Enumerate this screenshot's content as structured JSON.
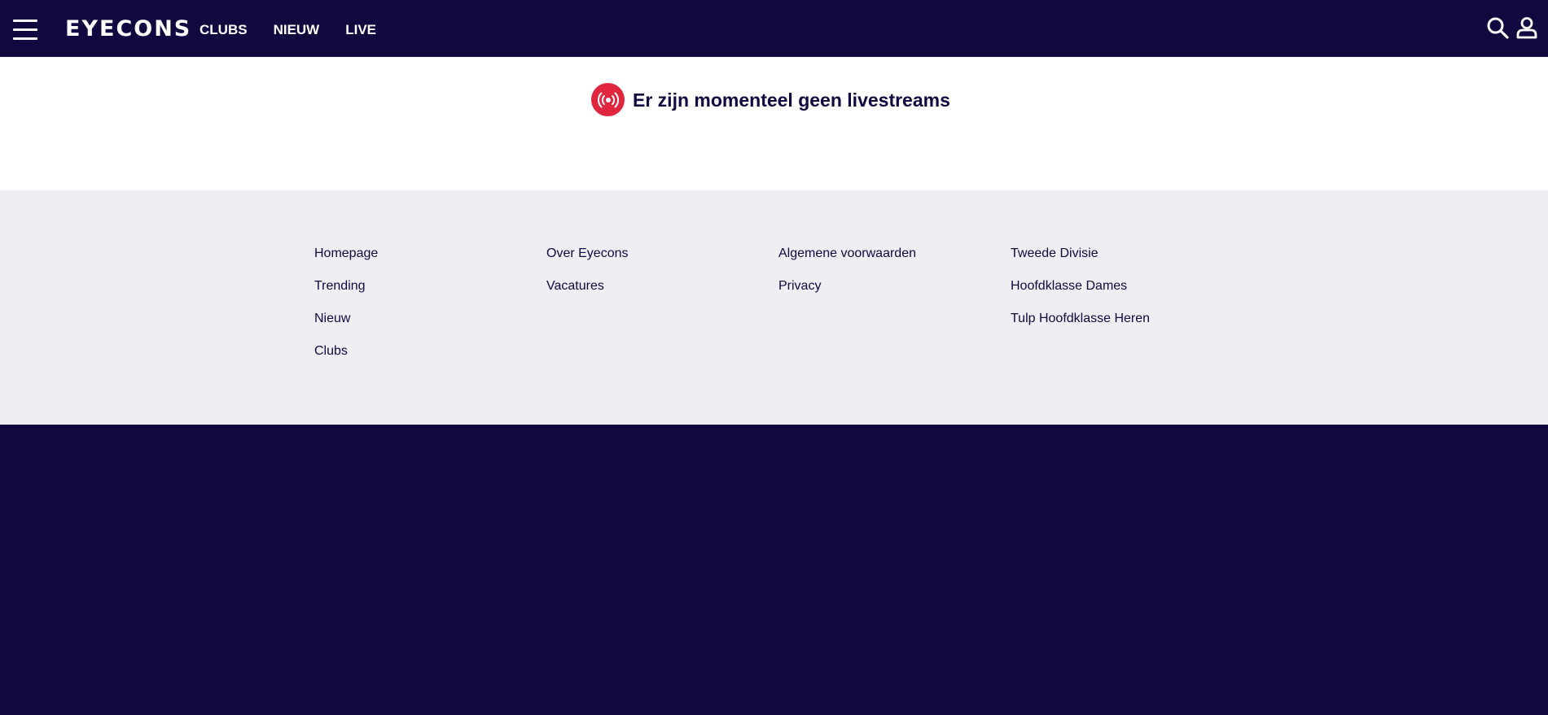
{
  "header": {
    "logo": "EYECONS",
    "nav": [
      {
        "label": "CLUBS"
      },
      {
        "label": "NIEUW"
      },
      {
        "label": "LIVE"
      }
    ],
    "icons": [
      "menu-icon",
      "search-icon",
      "user-icon"
    ]
  },
  "main": {
    "live_message": "Er zijn momenteel geen livestreams",
    "live_icon": "broadcast-icon"
  },
  "footer": {
    "columns": [
      {
        "links": [
          "Homepage",
          "Trending",
          "Nieuw",
          "Clubs"
        ]
      },
      {
        "links": [
          "Over Eyecons",
          "Vacatures"
        ]
      },
      {
        "links": [
          "Algemene voorwaarden",
          "Privacy"
        ]
      },
      {
        "links": [
          "Tweede Divisie",
          "Hoofdklasse Dames",
          "Tulp Hoofdklasse Heren"
        ]
      }
    ]
  },
  "colors": {
    "navy": "#110840",
    "live_red": "#e0253e",
    "footer_bg": "#efeef3",
    "white": "#ffffff"
  }
}
